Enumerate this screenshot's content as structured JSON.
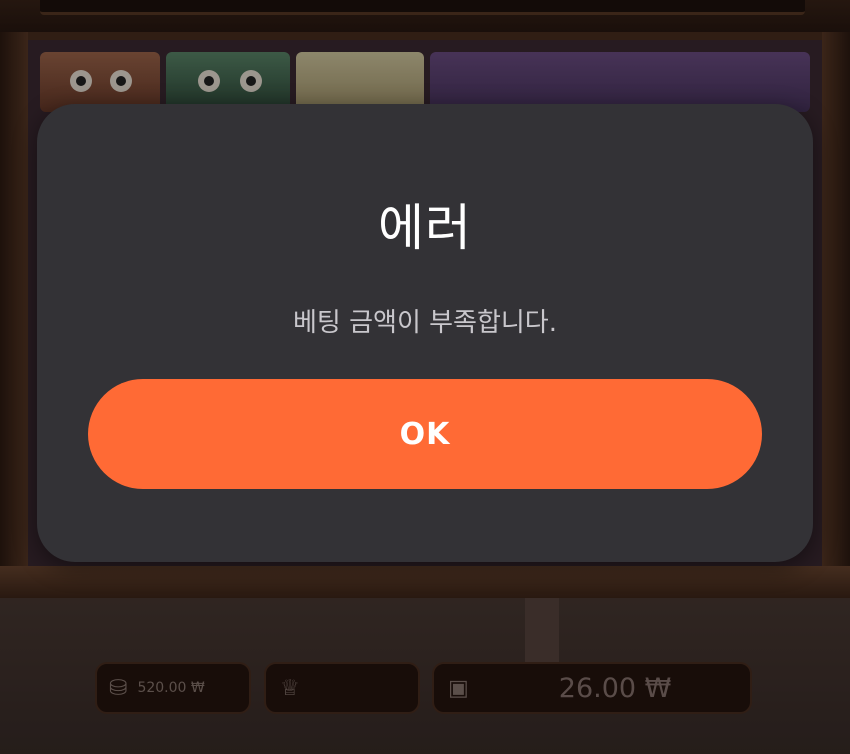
{
  "dialog": {
    "title": "에러",
    "message": "베팅 금액이 부족합니다.",
    "ok_label": "OK"
  },
  "bottom_bar": {
    "balance": "520.00 ₩",
    "win": "",
    "bet": "26.00 ₩"
  },
  "icons": {
    "balance": "coins-icon",
    "win": "trophy-icon",
    "bet": "wallet-icon"
  },
  "colors": {
    "accent": "#ff6a35",
    "dialog_bg": "#333236"
  }
}
